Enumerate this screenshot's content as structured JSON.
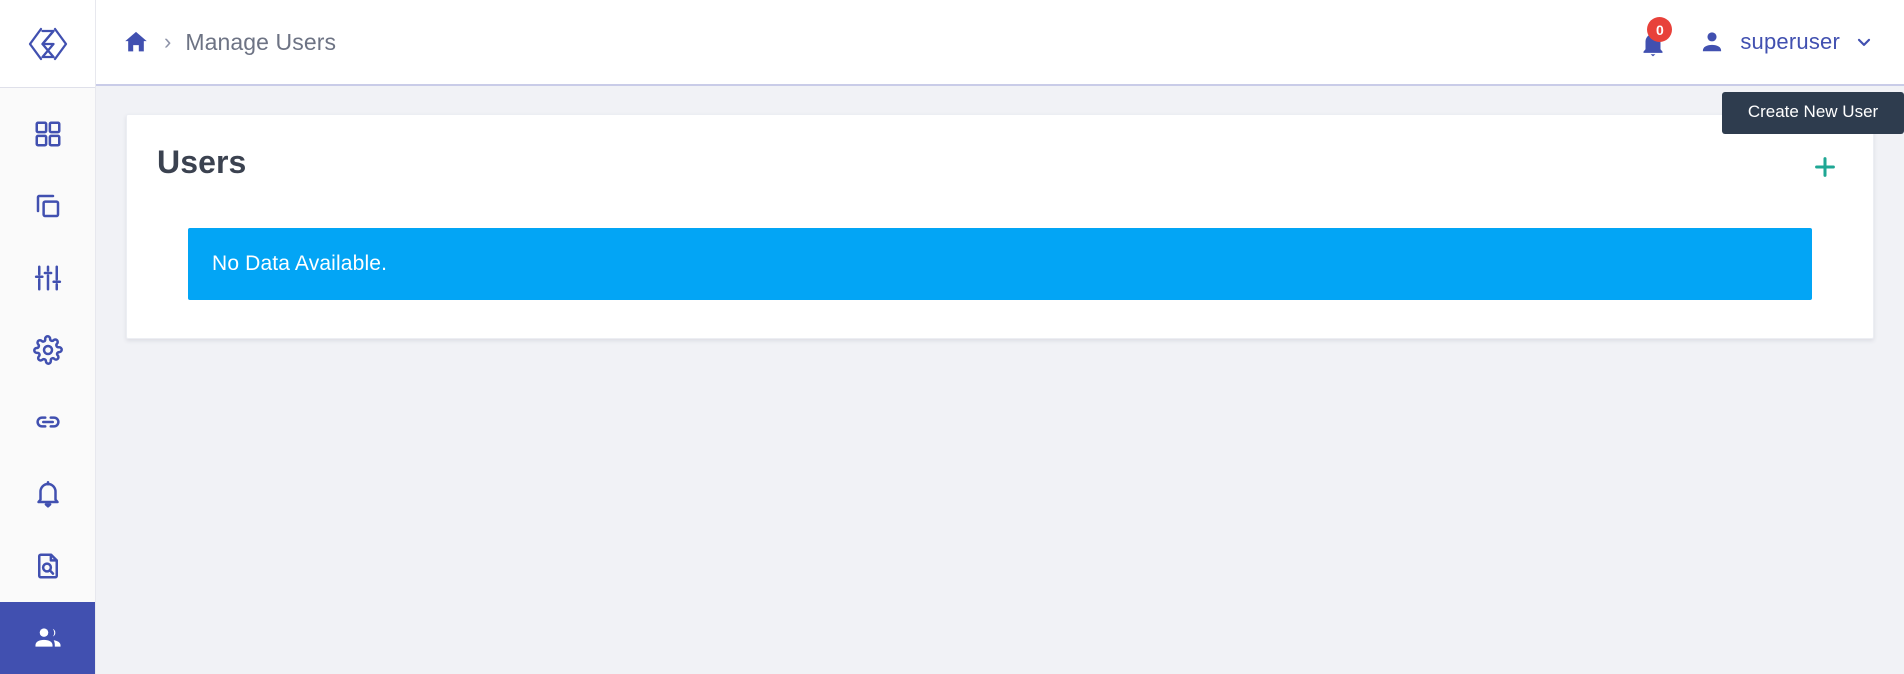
{
  "app": {
    "logo_name": "brand-logo",
    "brand_color": "#4150b0",
    "accent_add_color": "#1fa794",
    "alert_color": "#03a5f5",
    "badge_color": "#e8413a",
    "page_background": "#f1f2f6"
  },
  "sidebar": {
    "items": [
      {
        "name": "dashboard",
        "icon": "grid-dashboard-icon",
        "active": false
      },
      {
        "name": "projects",
        "icon": "layers-copy-icon",
        "active": false
      },
      {
        "name": "tuning",
        "icon": "sliders-tune-icon",
        "active": false
      },
      {
        "name": "settings",
        "icon": "gear-icon",
        "active": false
      },
      {
        "name": "links",
        "icon": "link-chain-icon",
        "active": false
      },
      {
        "name": "alerts",
        "icon": "bell-icon",
        "active": false
      },
      {
        "name": "reports",
        "icon": "document-search-icon",
        "active": false
      },
      {
        "name": "users",
        "icon": "people-icon",
        "active": true
      }
    ]
  },
  "header": {
    "breadcrumb": {
      "home_icon": "home-icon",
      "separator": "›",
      "current": "Manage Users"
    },
    "notifications": {
      "icon": "bell-icon",
      "count": "0"
    },
    "user": {
      "icon": "person-icon",
      "name": "superuser",
      "caret_icon": "chevron-down-icon"
    }
  },
  "main": {
    "card": {
      "title": "Users",
      "add_button": {
        "icon": "plus-icon",
        "label": "+"
      },
      "alert": {
        "message": "No Data Available."
      }
    }
  },
  "tooltip": {
    "text": "Create New User"
  }
}
